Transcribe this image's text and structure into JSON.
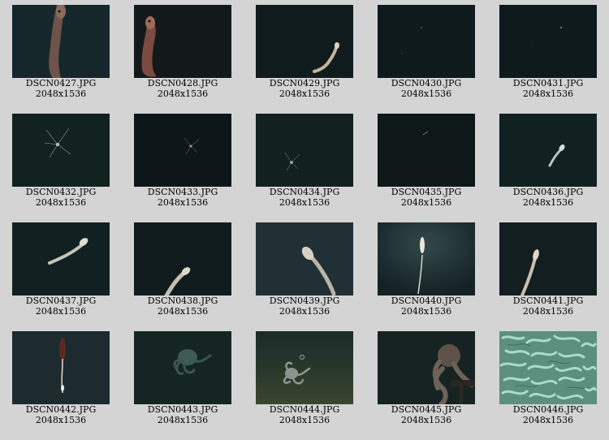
{
  "thumbnails": [
    {
      "filename": "DSCN0427.JPG",
      "dimensions": "2048x1536",
      "subject": "eel-closeup-icon"
    },
    {
      "filename": "DSCN0428.JPG",
      "dimensions": "2048x1536",
      "subject": "eel-closeup-icon"
    },
    {
      "filename": "DSCN0429.JPG",
      "dimensions": "2048x1536",
      "subject": "eel-icon"
    },
    {
      "filename": "DSCN0430.JPG",
      "dimensions": "2048x1536",
      "subject": "empty-water-icon"
    },
    {
      "filename": "DSCN0431.JPG",
      "dimensions": "2048x1536",
      "subject": "empty-water-icon"
    },
    {
      "filename": "DSCN0432.JPG",
      "dimensions": "2048x1536",
      "subject": "jellyfish-icon"
    },
    {
      "filename": "DSCN0433.JPG",
      "dimensions": "2048x1536",
      "subject": "jellyfish-icon"
    },
    {
      "filename": "DSCN0434.JPG",
      "dimensions": "2048x1536",
      "subject": "jellyfish-icon"
    },
    {
      "filename": "DSCN0435.JPG",
      "dimensions": "2048x1536",
      "subject": "empty-water-icon"
    },
    {
      "filename": "DSCN0436.JPG",
      "dimensions": "2048x1536",
      "subject": "fish-icon"
    },
    {
      "filename": "DSCN0437.JPG",
      "dimensions": "2048x1536",
      "subject": "fish-icon"
    },
    {
      "filename": "DSCN0438.JPG",
      "dimensions": "2048x1536",
      "subject": "fish-icon"
    },
    {
      "filename": "DSCN0439.JPG",
      "dimensions": "2048x1536",
      "subject": "fish-icon"
    },
    {
      "filename": "DSCN0440.JPG",
      "dimensions": "2048x1536",
      "subject": "fish-icon"
    },
    {
      "filename": "DSCN0441.JPG",
      "dimensions": "2048x1536",
      "subject": "fish-icon"
    },
    {
      "filename": "DSCN0442.JPG",
      "dimensions": "2048x1536",
      "subject": "fish-icon"
    },
    {
      "filename": "DSCN0443.JPG",
      "dimensions": "2048x1536",
      "subject": "octopus-icon"
    },
    {
      "filename": "DSCN0444.JPG",
      "dimensions": "2048x1536",
      "subject": "octopus-icon"
    },
    {
      "filename": "DSCN0445.JPG",
      "dimensions": "2048x1536",
      "subject": "octopus-icon"
    },
    {
      "filename": "DSCN0446.JPG",
      "dimensions": "2048x1536",
      "subject": "worm-mass-icon"
    }
  ],
  "colors": {
    "page_background": "#d4d4d4",
    "label_text": "#000000",
    "deep_water": "#0f1e21"
  }
}
